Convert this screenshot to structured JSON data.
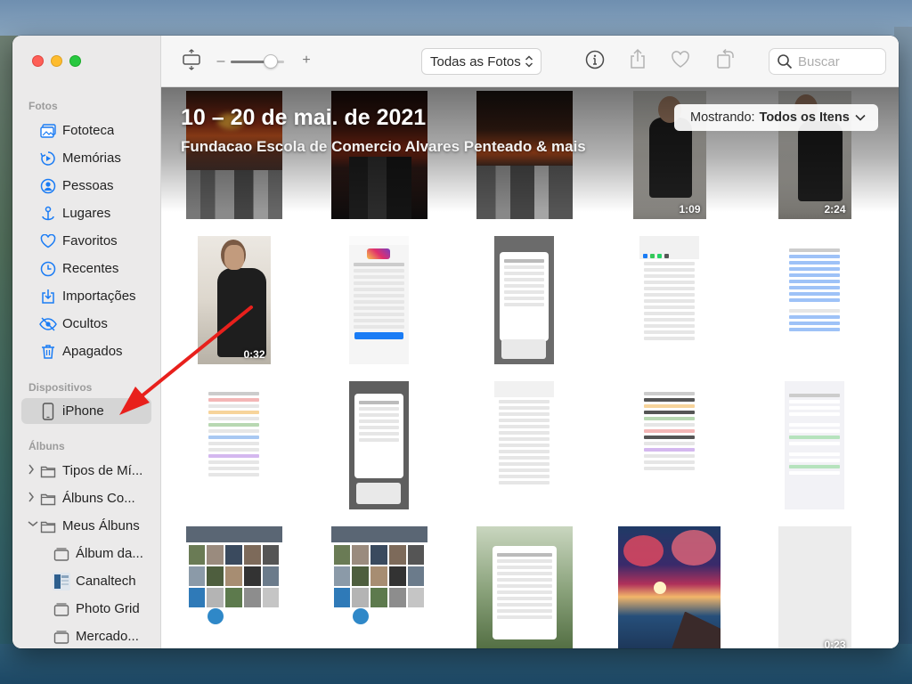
{
  "sidebar": {
    "sections": {
      "fotos": "Fotos",
      "dispositivos": "Dispositivos",
      "albuns": "Álbuns"
    },
    "fotos_items": [
      {
        "label": "Fototeca",
        "icon": "photos-library-icon"
      },
      {
        "label": "Memórias",
        "icon": "memories-icon"
      },
      {
        "label": "Pessoas",
        "icon": "people-icon"
      },
      {
        "label": "Lugares",
        "icon": "places-icon"
      },
      {
        "label": "Favoritos",
        "icon": "heart-icon"
      },
      {
        "label": "Recentes",
        "icon": "clock-icon"
      },
      {
        "label": "Importações",
        "icon": "import-icon"
      },
      {
        "label": "Ocultos",
        "icon": "eye-hidden-icon"
      },
      {
        "label": "Apagados",
        "icon": "trash-icon"
      }
    ],
    "device_items": [
      {
        "label": "iPhone",
        "icon": "iphone-icon"
      }
    ],
    "album_items": [
      {
        "label": "Tipos de Mí...",
        "icon": "folder-icon"
      },
      {
        "label": "Álbuns Co...",
        "icon": "folder-icon"
      },
      {
        "label": "Meus Álbuns",
        "icon": "folder-icon"
      },
      {
        "label": "Álbum da...",
        "icon": "album-icon"
      },
      {
        "label": "Canaltech",
        "icon": "album-thumbnail"
      },
      {
        "label": "Photo Grid",
        "icon": "album-icon"
      },
      {
        "label": "Mercado...",
        "icon": "album-icon"
      }
    ]
  },
  "toolbar": {
    "view_filter": "Todas as Fotos",
    "search_placeholder": "Buscar",
    "zoom_level": 0.75
  },
  "header": {
    "date_range": "10 – 20 de mai. de 2021",
    "location": "Fundacao Escola de Comercio Alvares Penteado & mais",
    "showing_label": "Mostrando:",
    "showing_value": "Todos os Itens"
  },
  "photos": [
    {
      "kind": "sunset",
      "duration": ""
    },
    {
      "kind": "sunset-dark",
      "duration": ""
    },
    {
      "kind": "sunset-city",
      "duration": ""
    },
    {
      "kind": "person-video",
      "duration": "1:09"
    },
    {
      "kind": "person-video",
      "duration": "2:24"
    },
    {
      "kind": "person-video-tall",
      "duration": "0:32"
    },
    {
      "kind": "screenshot-ios",
      "duration": ""
    },
    {
      "kind": "screenshot-ios-dark",
      "duration": ""
    },
    {
      "kind": "screenshot-share",
      "duration": ""
    },
    {
      "kind": "screenshot-menu",
      "duration": ""
    },
    {
      "kind": "screenshot-settings",
      "duration": ""
    },
    {
      "kind": "screenshot-ios-dark",
      "duration": ""
    },
    {
      "kind": "screenshot-share",
      "duration": ""
    },
    {
      "kind": "screenshot-settings",
      "duration": ""
    },
    {
      "kind": "screenshot-settings2",
      "duration": ""
    },
    {
      "kind": "screenshot-grid",
      "duration": ""
    },
    {
      "kind": "screenshot-grid",
      "duration": ""
    },
    {
      "kind": "screenshot-menu-green",
      "duration": ""
    },
    {
      "kind": "painting",
      "duration": ""
    },
    {
      "kind": "blank-video",
      "duration": "0:23"
    }
  ],
  "colors": {
    "accent": "#1a7cf5",
    "arrow": "#e8201c"
  }
}
